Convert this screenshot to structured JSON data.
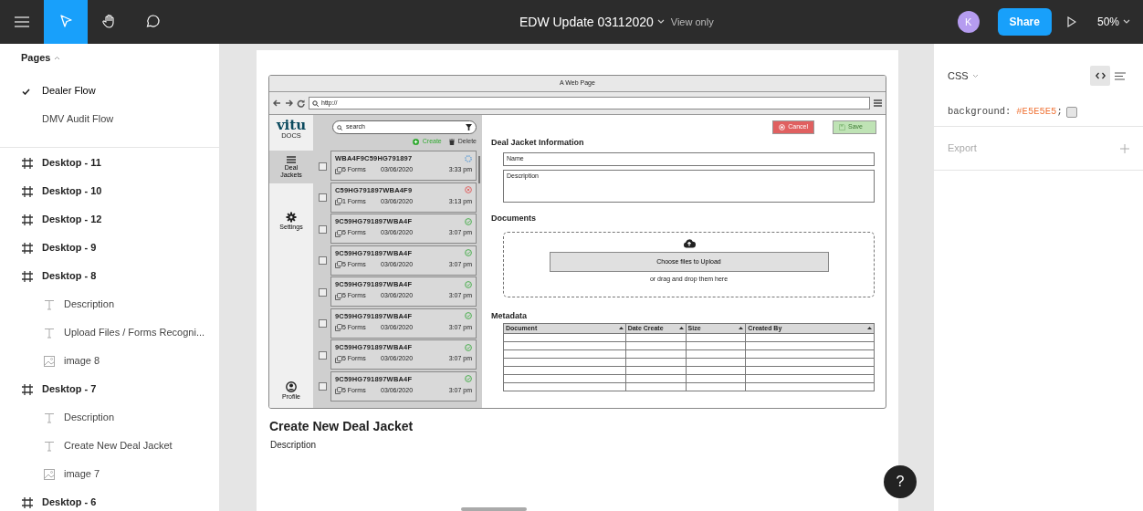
{
  "toolbar": {
    "title": "EDW Update 03112020",
    "mode": "View only",
    "avatar": "K",
    "share": "Share",
    "zoom": "50%"
  },
  "tools": [
    {
      "kind": "move",
      "selected": true
    },
    {
      "kind": "hand",
      "selected": false
    },
    {
      "kind": "comment",
      "selected": false
    }
  ],
  "pages": {
    "heading": "Pages",
    "items": [
      {
        "label": "Dealer Flow",
        "selected": true
      },
      {
        "label": "DMV Audit Flow",
        "selected": false
      }
    ]
  },
  "layers": [
    {
      "kind": "frame",
      "label": "Desktop - 11"
    },
    {
      "kind": "frame",
      "label": "Desktop - 10"
    },
    {
      "kind": "frame",
      "label": "Desktop - 12"
    },
    {
      "kind": "frame",
      "label": "Desktop - 9"
    },
    {
      "kind": "frame",
      "label": "Desktop - 8",
      "children": [
        {
          "kind": "text",
          "label": "Description"
        },
        {
          "kind": "text",
          "label": "Upload Files / Forms Recogni..."
        },
        {
          "kind": "image",
          "label": "image 8"
        }
      ]
    },
    {
      "kind": "frame",
      "label": "Desktop - 7",
      "children": [
        {
          "kind": "text",
          "label": "Description"
        },
        {
          "kind": "text",
          "label": "Create New Deal Jacket"
        },
        {
          "kind": "image",
          "label": "image 7"
        }
      ]
    },
    {
      "kind": "frame",
      "label": "Desktop - 6"
    }
  ],
  "wireframe": {
    "window_title": "A Web Page",
    "url": "http://",
    "logo": "vitu",
    "logo_sub": "DOCS",
    "nav": [
      {
        "kind": "list",
        "label": "Deal Jackets",
        "selected": true
      },
      {
        "kind": "gear",
        "label": "Settings",
        "selected": false
      },
      {
        "kind": "user",
        "label": "Profile",
        "selected": false
      }
    ],
    "search_placeholder": "search",
    "create": "Create",
    "delete": "Delete",
    "jackets": [
      {
        "vin": "WBA4F9C59HG791897",
        "forms": "5 Forms",
        "date": "03/06/2020",
        "time": "3:33 pm",
        "kind": "pending",
        "checked": false
      },
      {
        "vin": "C59HG791897WBA4F9",
        "forms": "1 Forms",
        "date": "03/06/2020",
        "time": "3:13 pm",
        "kind": "error",
        "checked": false
      },
      {
        "vin": "9C59HG791897WBA4F",
        "forms": "5 Forms",
        "date": "03/06/2020",
        "time": "3:07 pm",
        "kind": "ok",
        "checked": false
      },
      {
        "vin": "9C59HG791897WBA4F",
        "forms": "5 Forms",
        "date": "03/06/2020",
        "time": "3:07 pm",
        "kind": "ok",
        "checked": false
      },
      {
        "vin": "9C59HG791897WBA4F",
        "forms": "5 Forms",
        "date": "03/06/2020",
        "time": "3:07 pm",
        "kind": "ok",
        "checked": false
      },
      {
        "vin": "9C59HG791897WBA4F",
        "forms": "5 Forms",
        "date": "03/06/2020",
        "time": "3:07 pm",
        "kind": "ok",
        "checked": false
      },
      {
        "vin": "9C59HG791897WBA4F",
        "forms": "5 Forms",
        "date": "03/06/2020",
        "time": "3:07 pm",
        "kind": "ok",
        "checked": false
      },
      {
        "vin": "9C59HG791897WBA4F",
        "forms": "5 Forms",
        "date": "03/06/2020",
        "time": "3:07 pm",
        "kind": "ok",
        "checked": false
      }
    ],
    "cancel": {
      "label": "Cancel",
      "disabled": false
    },
    "save": {
      "label": "Save",
      "disabled": true
    },
    "info_heading": "Deal Jacket Information",
    "name_placeholder": "Name",
    "description_placeholder": "Description",
    "documents_heading": "Documents",
    "upload_button": "Choose files to Upload",
    "upload_hint": "or drag and drop them here",
    "metadata_heading": "Metadata",
    "columns": [
      "Document",
      "Date Create",
      "Size",
      "Created By"
    ]
  },
  "frame_caption": {
    "title": "Create New Deal Jacket",
    "text": "Description"
  },
  "inspector": {
    "tab": "CSS",
    "property": "background:",
    "value": "#E5E5E5",
    "terminator": ";",
    "export": "Export"
  },
  "help": "?"
}
